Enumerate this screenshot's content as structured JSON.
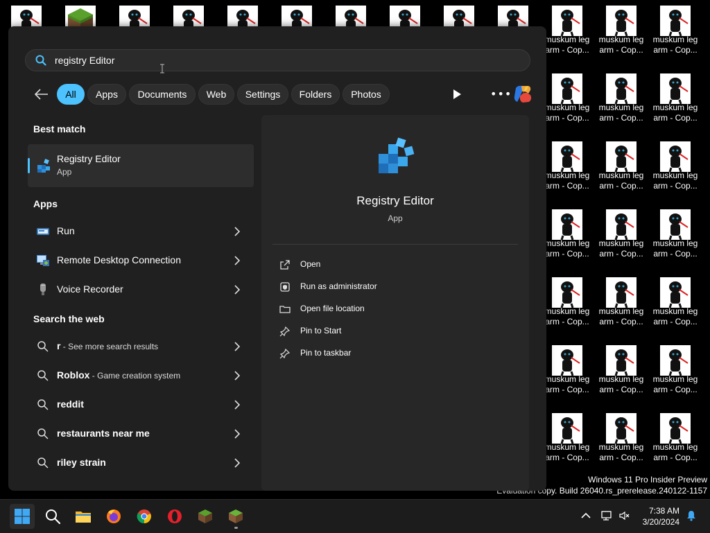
{
  "desktop": {
    "icon_label_line1": "muskum leg",
    "icon_label_line2": "arm - Cop...",
    "watermark_line1": "Windows 11 Pro Insider Preview",
    "watermark_line2": "Evaluation copy. Build 26040.rs_prerelease.240122-1157"
  },
  "search": {
    "query": "registry Editor",
    "filters": [
      "All",
      "Apps",
      "Documents",
      "Web",
      "Settings",
      "Folders",
      "Photos"
    ],
    "active_filter": "All"
  },
  "results": {
    "best_match_title": "Best match",
    "best_match": {
      "name": "Registry Editor",
      "type": "App"
    },
    "apps_title": "Apps",
    "apps": [
      "Run",
      "Remote Desktop Connection",
      "Voice Recorder"
    ],
    "web_title": "Search the web",
    "web": [
      {
        "term": "r",
        "sub": " - See more search results"
      },
      {
        "term": "Roblox",
        "sub": " - Game creation system"
      },
      {
        "term": "reddit",
        "sub": ""
      },
      {
        "term": "restaurants near me",
        "sub": ""
      },
      {
        "term": "riley strain",
        "sub": ""
      }
    ]
  },
  "preview": {
    "title": "Registry Editor",
    "type": "App",
    "actions": [
      "Open",
      "Run as administrator",
      "Open file location",
      "Pin to Start",
      "Pin to taskbar"
    ]
  },
  "taskbar": {
    "time": "7:38 AM",
    "date": "3/20/2024",
    "apps": [
      "start-icon",
      "search-icon",
      "file-explorer-icon",
      "firefox-icon",
      "chrome-icon",
      "opera-icon",
      "minecraft-icon",
      "minecraft-launcher-icon"
    ]
  },
  "colors": {
    "accent": "#4cc2ff",
    "panel": "#202020",
    "preview": "#272727",
    "taskbar": "#1c1c1c"
  }
}
